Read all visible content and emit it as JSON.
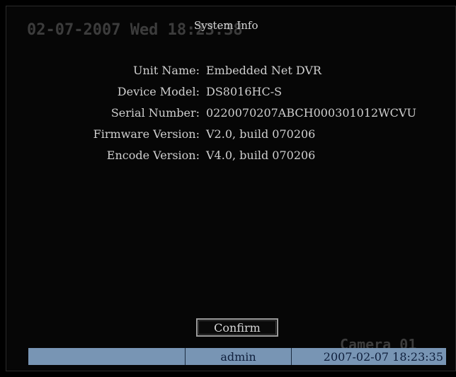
{
  "overlay": {
    "datetime": "02-07-2007 Wed 18:23:38",
    "camera": "Camera 01"
  },
  "window": {
    "title": "System Info"
  },
  "info": [
    {
      "label": "Unit Name:",
      "value": "Embedded Net DVR"
    },
    {
      "label": "Device Model:",
      "value": "DS8016HC-S"
    },
    {
      "label": "Serial Number:",
      "value": "0220070207ABCH000301012WCVU"
    },
    {
      "label": "Firmware Version:",
      "value": "V2.0, build 070206"
    },
    {
      "label": "Encode Version:",
      "value": "V4.0, build 070206"
    }
  ],
  "buttons": {
    "confirm": "Confirm"
  },
  "statusbar": {
    "section1": "",
    "user": "admin",
    "datetime": "2007-02-07 18:23:35"
  },
  "colors": {
    "background": "#060606",
    "text": "#cfcfcf",
    "statusbar": "#7895b4"
  }
}
